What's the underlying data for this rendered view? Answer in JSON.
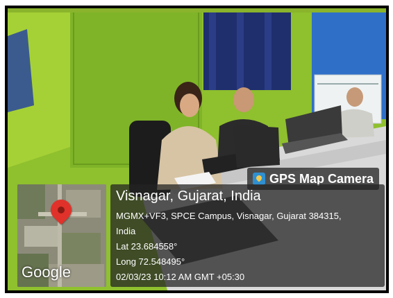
{
  "badge": {
    "label": "GPS Map Camera",
    "icon": "map-pin-icon"
  },
  "location": {
    "title": "Visnagar, Gujarat, India",
    "address_line1": "MGMX+VF3, SPCE Campus, Visnagar, Gujarat 384315,",
    "address_line2": "India",
    "lat": "Lat 23.684558°",
    "long": "Long 72.548495°",
    "datetime": "02/03/23 10:12 AM GMT +05:30"
  },
  "map": {
    "logo": "Google",
    "pin_color": "#e0322a"
  },
  "colors": {
    "wall": "#9acd32",
    "wall_blue": "#2f6fc8",
    "desk": "#d8d8d8"
  }
}
